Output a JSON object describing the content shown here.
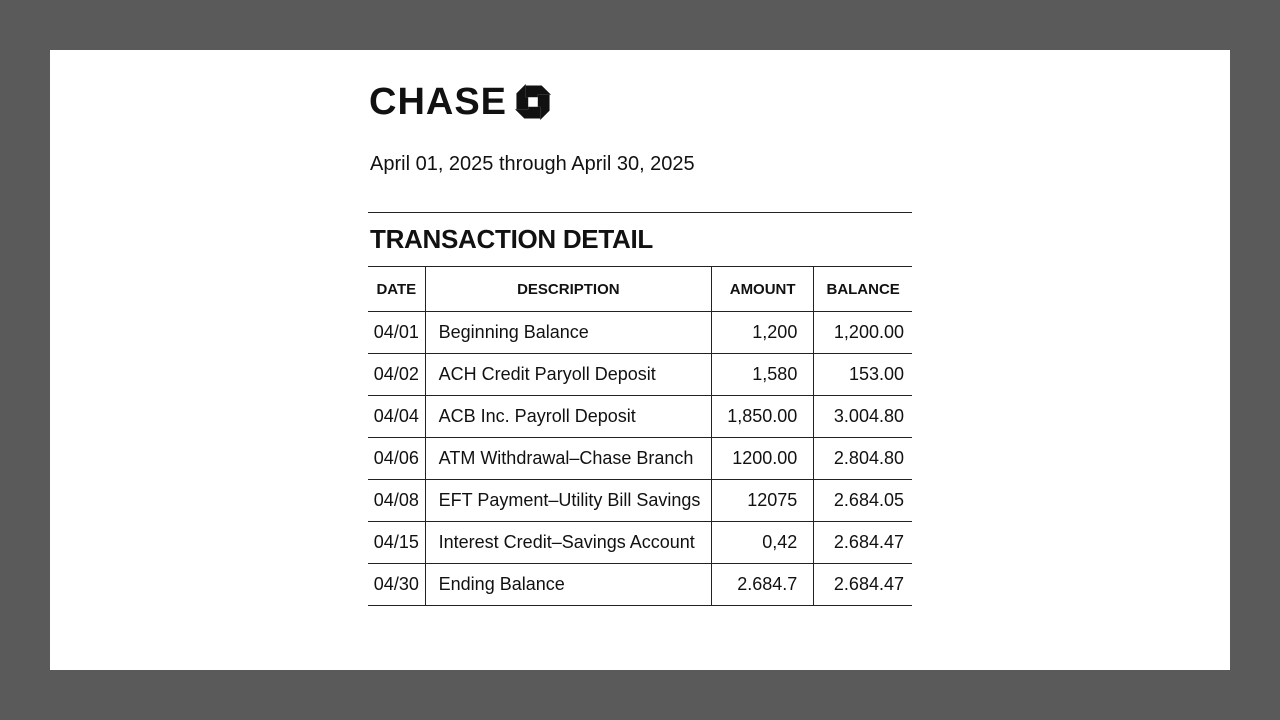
{
  "bank": {
    "name": "CHASE",
    "logo_icon": "chase-octagon-icon"
  },
  "statement": {
    "period": "April 01, 2025 through April 30, 2025",
    "section_title": "TRANSACTION DETAIL"
  },
  "table": {
    "headers": {
      "date": "DATE",
      "description": "DESCRIPTION",
      "amount": "AMOUNT",
      "balance": "BALANCE"
    },
    "rows": [
      {
        "date": "04/01",
        "description": "Beginning Balance",
        "amount": "1,200",
        "balance": "1,200.00"
      },
      {
        "date": "04/02",
        "description": "ACH Credit Paryoll Deposit",
        "amount": "1,580",
        "balance": "153.00"
      },
      {
        "date": "04/04",
        "description": "ACB Inc. Payroll Deposit",
        "amount": "1,850.00",
        "balance": "3.004.80"
      },
      {
        "date": "04/06",
        "description": "ATM Withdrawal–Chase Branch",
        "amount": "1200.00",
        "balance": "2.804.80"
      },
      {
        "date": "04/08",
        "description": "EFT Payment–Utility Bill Savings",
        "amount": "12075",
        "balance": "2.684.05"
      },
      {
        "date": "04/15",
        "description": "Interest Credit–Savings Account",
        "amount": "0,42",
        "balance": "2.684.47"
      },
      {
        "date": "04/30",
        "description": "Ending Balance",
        "amount": "2.684.7",
        "balance": "2.684.47"
      }
    ]
  },
  "colors": {
    "backdrop": "#5a5a5a",
    "page": "#ffffff",
    "ink": "#111111"
  }
}
